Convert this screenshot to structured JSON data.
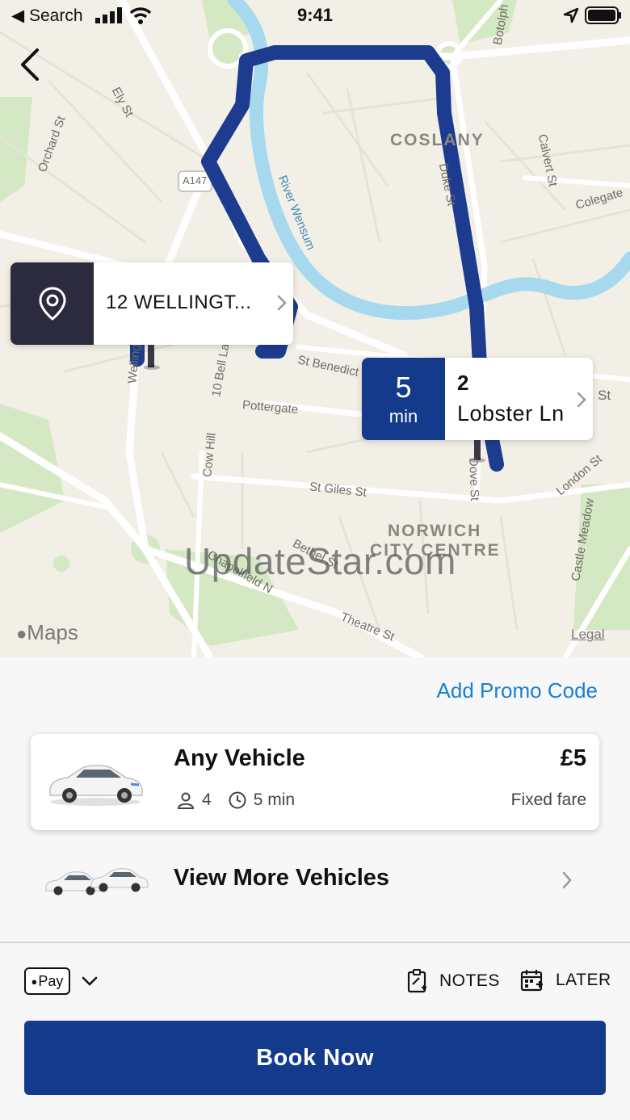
{
  "status_bar": {
    "back_label": "◀ Search",
    "time": "9:41"
  },
  "map": {
    "districts": [
      "COSLANY",
      "NORWICH",
      "CITY CENTRE"
    ],
    "streets": [
      "Ely St",
      "Orchard St",
      "A147",
      "River Wensum",
      "Duke St",
      "Calvert St",
      "Colegate",
      "Botolph",
      "St Benedict",
      "Pottergate",
      "10 Bell La",
      "Cow Hill",
      "St Giles St",
      "Dove St",
      "London St",
      "Castle Meadow",
      "Bethel St",
      "Chapelfield N",
      "Theatre St",
      "Wellingt",
      "St"
    ],
    "maps_logo": "Maps",
    "legal": "Legal",
    "watermark": "UpdateStar.com"
  },
  "pickup": {
    "address": "12 WELLINGT...",
    "icon": "location-pin-icon"
  },
  "dropoff": {
    "eta_value": "5",
    "eta_unit": "min",
    "line1": "2",
    "line2": "Lobster Ln"
  },
  "booking": {
    "promo_label": "Add Promo Code",
    "vehicle": {
      "name": "Any Vehicle",
      "passengers": "4",
      "eta": "5 min",
      "price": "£5",
      "fare_type": "Fixed fare"
    },
    "more_vehicles_label": "View More Vehicles",
    "payment_label": "Pay",
    "notes_label": "NOTES",
    "later_label": "LATER",
    "book_label": "Book Now"
  },
  "colors": {
    "brand_blue": "#143a8c",
    "route_blue": "#1d3c8f",
    "link_blue": "#1a7fd6",
    "pickup_dark": "#2b2a3f",
    "river": "#a7d9ee"
  }
}
